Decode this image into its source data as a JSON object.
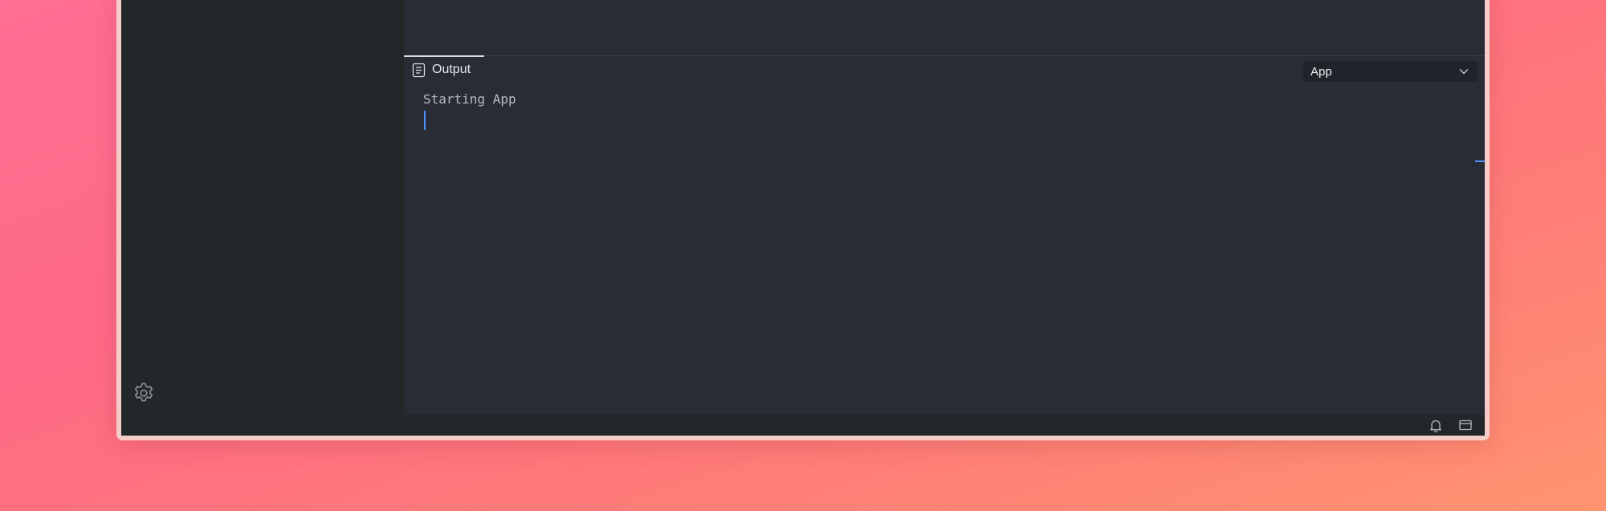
{
  "sidebar": {
    "settings_icon": "gear-icon"
  },
  "panel": {
    "tab": {
      "label": "Output",
      "icon": "clipboard-list-icon"
    },
    "channel_select": {
      "value": "App",
      "icon": "chevron-down-icon"
    },
    "output_lines": [
      "Starting App"
    ]
  },
  "status_bar": {
    "icons": [
      "bell-icon",
      "panel-layout-icon"
    ]
  },
  "colors": {
    "cursor_accent": "#4f8ff7",
    "editor_bg": "#292c35",
    "sidebar_bg": "#222729"
  }
}
